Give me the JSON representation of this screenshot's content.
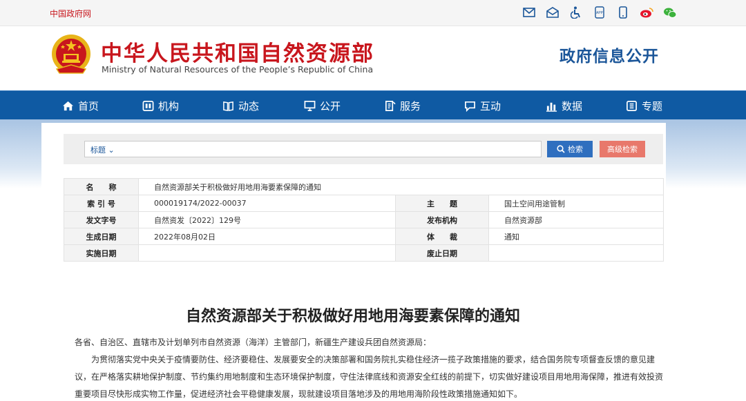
{
  "topbar": {
    "gov_link": "中国政府网",
    "icons": [
      "mail-icon",
      "mail-open-icon",
      "accessibility-icon",
      "app-icon",
      "mobile-icon",
      "weibo-icon",
      "wechat-icon"
    ]
  },
  "header": {
    "title_cn": "中华人民共和国自然资源部",
    "title_en": "Ministry of Natural Resources of the People’s Republic of China",
    "gov_info": "政府信息公开"
  },
  "nav": {
    "items": [
      {
        "label": "首页",
        "icon": "home-icon"
      },
      {
        "label": "机构",
        "icon": "org-icon"
      },
      {
        "label": "动态",
        "icon": "news-icon"
      },
      {
        "label": "公开",
        "icon": "monitor-icon"
      },
      {
        "label": "服务",
        "icon": "service-icon"
      },
      {
        "label": "互动",
        "icon": "chat-icon"
      },
      {
        "label": "数据",
        "icon": "chart-icon"
      },
      {
        "label": "专题",
        "icon": "topic-icon"
      }
    ]
  },
  "search": {
    "type": "标题 ⌄",
    "button": "检索",
    "advanced": "高级检索"
  },
  "meta": {
    "name_label": "名　　称",
    "name_value": "自然资源部关于积极做好用地用海要素保障的通知",
    "index_label": "索 引 号",
    "index_value": "000019174/2022-00037",
    "topic_label": "主　　题",
    "topic_value": "国土空间用途管制",
    "doc_no_label": "发文字号",
    "doc_no_value": "自然资发〔2022〕129号",
    "publisher_label": "发布机构",
    "publisher_value": "自然资源部",
    "created_label": "生成日期",
    "created_value": "2022年08月02日",
    "genre_label": "体　　裁",
    "genre_value": "通知",
    "effective_label": "实施日期",
    "effective_value": "",
    "expiry_label": "废止日期",
    "expiry_value": ""
  },
  "article": {
    "title": "自然资源部关于积极做好用地用海要素保障的通知",
    "salutation": "各省、自治区、直辖市及计划单列市自然资源（海洋）主管部门，新疆生产建设兵团自然资源局：",
    "body": "为贯彻落实党中央关于疫情要防住、经济要稳住、发展要安全的决策部署和国务院扎实稳住经济一揽子政策措施的要求，结合国务院专项督查反馈的意见建议，在严格落实耕地保护制度、节约集约用地制度和生态环境保护制度，守住法律底线和资源安全红线的前提下，切实做好建设项目用地用海保障，推进有效投资重要项目尽快形成实物工作量，促进经济社会平稳健康发展，现就建设项目落地涉及的用地用海阶段性政策措施通知如下。"
  },
  "colors": {
    "brand_red": "#c8161d",
    "nav_blue": "#0f5aa3",
    "title_blue": "#1b5699",
    "search_blue": "#2f6fbf",
    "advanced_red": "#e8786b"
  }
}
